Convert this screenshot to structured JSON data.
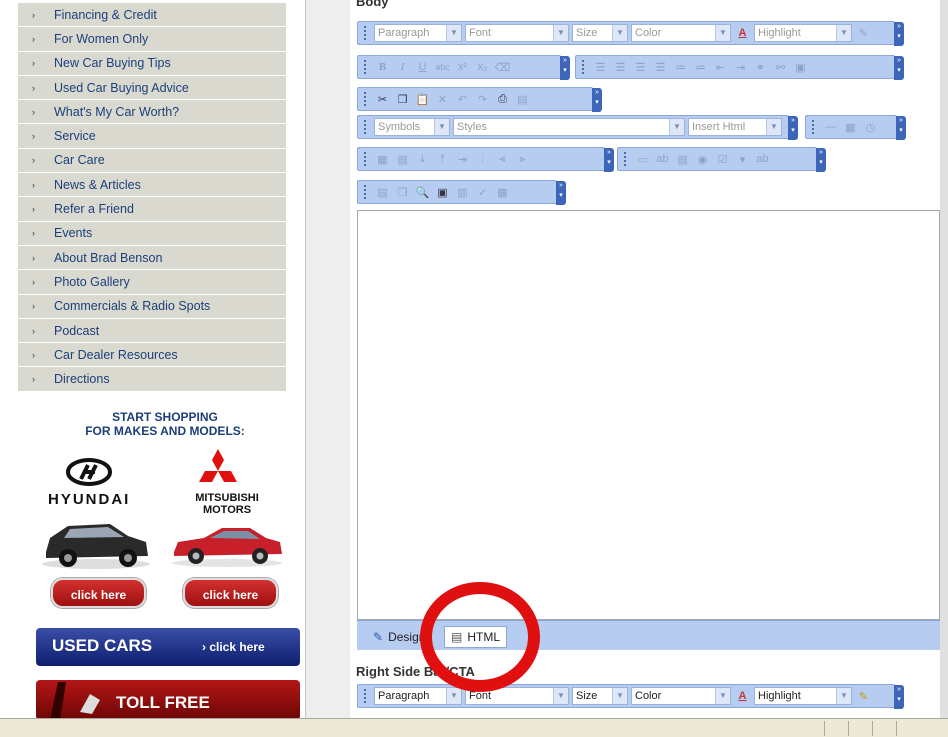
{
  "sidebar": {
    "nav_items": [
      "Financing & Credit",
      "For Women Only",
      "New Car Buying Tips",
      "Used Car Buying Advice",
      "What's My Car Worth?",
      "Service",
      "Car Care",
      "News & Articles",
      "Refer a Friend",
      "Events",
      "About Brad Benson",
      "Photo Gallery",
      "Commercials & Radio Spots",
      "Podcast",
      "Car Dealer Resources",
      "Directions"
    ],
    "shop_title_line1": "START SHOPPING",
    "shop_title_line2": "FOR MAKES AND MODELS:",
    "hyundai": "HYUNDAI",
    "mitsubishi_line1": "MITSUBISHI",
    "mitsubishi_line2": "MOTORS",
    "click_here": "click here",
    "used_cars": "USED CARS",
    "used_cars_cta": "› click here",
    "toll_free": "TOLL FREE"
  },
  "editor": {
    "body_label": "Body",
    "toolbar1": {
      "paragraph": "Paragraph",
      "font": "Font",
      "size": "Size",
      "color": "Color",
      "highlight": "Highlight"
    },
    "toolbar4": {
      "symbols": "Symbols",
      "styles": "Styles",
      "insert_html": "Insert Html"
    },
    "mode_design": "Design",
    "mode_html": "HTML",
    "right_label": "Right Side Bar/CTA",
    "toolbar_bottom": {
      "paragraph": "Paragraph",
      "font": "Font",
      "size": "Size",
      "color": "Color",
      "highlight": "Highlight"
    }
  },
  "colors": {
    "accent": "#b7ccf1",
    "annotation": "#e01010",
    "nav_bg": "#d9d9d0",
    "nav_text": "#1c3f7a"
  }
}
